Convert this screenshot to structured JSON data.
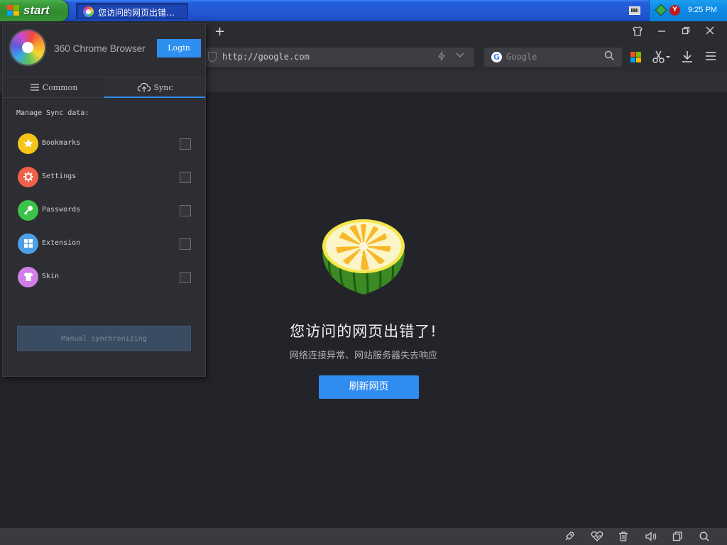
{
  "taskbar": {
    "start_label": "start",
    "task_title": "您访问的网页出错…",
    "clock": "9:25 PM"
  },
  "browser": {
    "new_tab_symbol": "+",
    "address": "http://google.com",
    "search_placeholder": "Google"
  },
  "page": {
    "error_title": "您访问的网页出错了!",
    "error_subtitle": "网络连接异常、网站服务器失去响应",
    "refresh_label": "刷新网页"
  },
  "panel": {
    "brand": "360 Chrome Browser",
    "login_label": "Login",
    "tabs": [
      {
        "label": "Common",
        "icon": "menu-icon"
      },
      {
        "label": "Sync",
        "icon": "cloud-upload-icon"
      }
    ],
    "active_tab": "Sync",
    "manage_label": "Manage Sync data:",
    "items": [
      {
        "label": "Bookmarks",
        "icon": "star-icon",
        "color": "#f5c518",
        "checked": false
      },
      {
        "label": "Settings",
        "icon": "gear-icon",
        "color": "#f0604a",
        "checked": false
      },
      {
        "label": "Passwords",
        "icon": "key-icon",
        "color": "#3cc34a",
        "checked": false
      },
      {
        "label": "Extension",
        "icon": "grid-icon",
        "color": "#4ea0e6",
        "checked": false
      },
      {
        "label": "Skin",
        "icon": "shirt-icon",
        "color": "#d27ee8",
        "checked": false
      }
    ],
    "manual_sync_label": "Manual synchronizing"
  },
  "colors": {
    "accent": "#2f8cf0",
    "panel_bg": "#2d2e33",
    "page_bg": "#23242a"
  }
}
